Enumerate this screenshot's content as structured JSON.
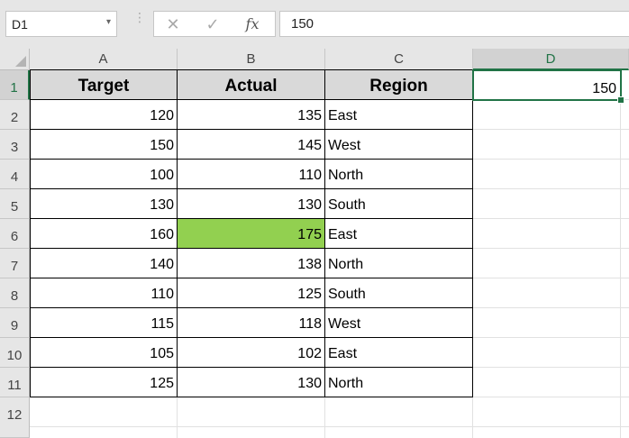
{
  "formula_bar": {
    "name_box": "D1",
    "name_box_arrow": "▾",
    "grip": "⋮",
    "cancel_icon": "✕",
    "enter_icon": "✓",
    "fx_label": "fx",
    "formula": "150"
  },
  "columns": [
    "A",
    "B",
    "C",
    "D"
  ],
  "rows": [
    "1",
    "2",
    "3",
    "4",
    "5",
    "6",
    "7",
    "8",
    "9",
    "10",
    "11",
    "12"
  ],
  "table": {
    "headers": [
      "Target",
      "Actual",
      "Region"
    ],
    "data": [
      [
        "120",
        "135",
        "East"
      ],
      [
        "150",
        "145",
        "West"
      ],
      [
        "100",
        "110",
        "North"
      ],
      [
        "130",
        "130",
        "South"
      ],
      [
        "160",
        "175",
        "East"
      ],
      [
        "140",
        "138",
        "North"
      ],
      [
        "110",
        "125",
        "South"
      ],
      [
        "115",
        "118",
        "West"
      ],
      [
        "105",
        "102",
        "East"
      ],
      [
        "125",
        "130",
        "North"
      ]
    ]
  },
  "selected_cell": {
    "ref": "D1",
    "value": "150"
  },
  "colors": {
    "highlight": "#92d050",
    "header_fill": "#d9d9d9",
    "selection": "#217346"
  }
}
